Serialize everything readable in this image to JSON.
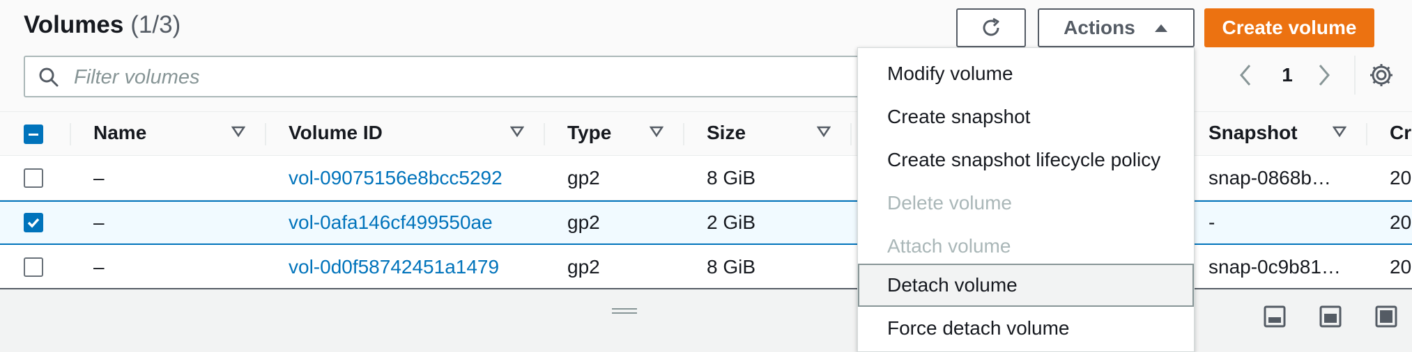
{
  "header": {
    "title": "Volumes",
    "count": "(1/3)",
    "actions_label": "Actions",
    "create_label": "Create volume"
  },
  "filter": {
    "placeholder": "Filter volumes"
  },
  "pagination": {
    "page": "1"
  },
  "table": {
    "columns": [
      "Name",
      "Volume ID",
      "Type",
      "Size",
      "Snapshot",
      "Cre"
    ],
    "rows": [
      {
        "name": "–",
        "volume_id": "vol-09075156e8bcc5292",
        "type": "gp2",
        "size": "8 GiB",
        "snapshot": "snap-0868b…",
        "created": "20",
        "selected": false
      },
      {
        "name": "–",
        "volume_id": "vol-0afa146cf499550ae",
        "type": "gp2",
        "size": "2 GiB",
        "snapshot": "-",
        "created": "20",
        "selected": true
      },
      {
        "name": "–",
        "volume_id": "vol-0d0f58742451a1479",
        "type": "gp2",
        "size": "8 GiB",
        "snapshot": "snap-0c9b81…",
        "created": "20",
        "selected": false
      }
    ]
  },
  "actions_menu": {
    "items": [
      {
        "label": "Modify volume",
        "disabled": false
      },
      {
        "label": "Create snapshot",
        "disabled": false
      },
      {
        "label": "Create snapshot lifecycle policy",
        "disabled": false
      },
      {
        "label": "Delete volume",
        "disabled": true
      },
      {
        "label": "Attach volume",
        "disabled": true
      },
      {
        "label": "Detach volume",
        "disabled": false,
        "hovered": true
      },
      {
        "label": "Force detach volume",
        "disabled": false
      }
    ]
  },
  "colors": {
    "primary": "#ec7211",
    "link": "#0073bb",
    "selected_bg": "#f1faff",
    "disabled_text": "#aab7b8"
  },
  "icons": [
    "refresh-icon",
    "caret-up-icon",
    "search-icon",
    "chevron-left-icon",
    "chevron-right-icon",
    "gear-icon",
    "sort-icon",
    "panel-bottom-icon",
    "panel-side-icon",
    "panel-full-icon"
  ]
}
